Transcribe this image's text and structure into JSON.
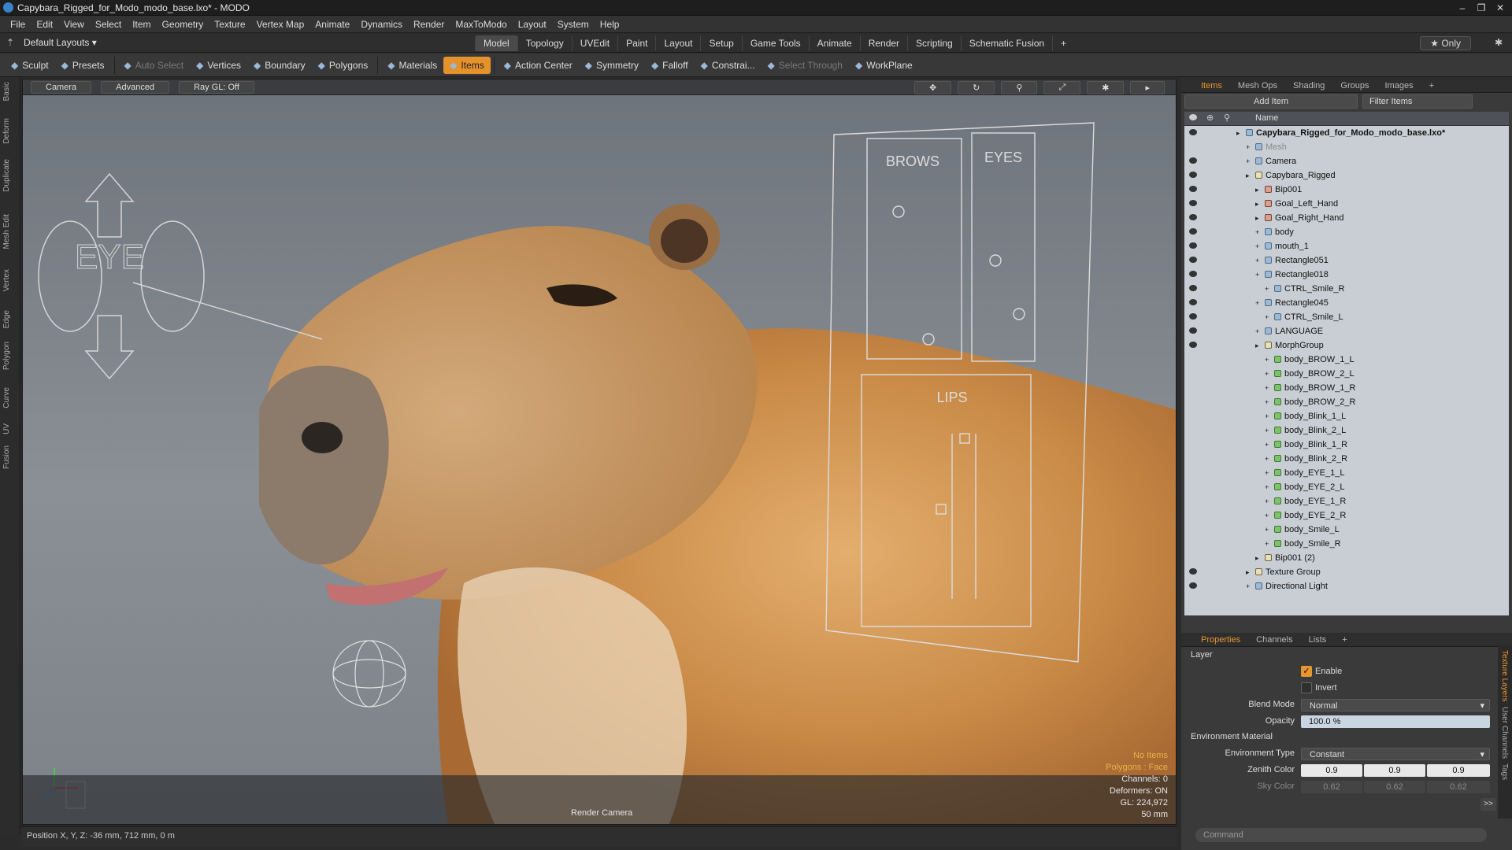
{
  "window": {
    "title": "Capybara_Rigged_for_Modo_modo_base.lxo* - MODO"
  },
  "menu": [
    "File",
    "Edit",
    "View",
    "Select",
    "Item",
    "Geometry",
    "Texture",
    "Vertex Map",
    "Animate",
    "Dynamics",
    "Render",
    "MaxToModo",
    "Layout",
    "System",
    "Help"
  ],
  "layout": {
    "default_layouts": "Default Layouts ▾",
    "tabs": [
      "Model",
      "Topology",
      "UVEdit",
      "Paint",
      "Layout",
      "Setup",
      "Game Tools",
      "Animate",
      "Render",
      "Scripting",
      "Schematic Fusion",
      "+"
    ],
    "active_tab": "Model",
    "only": "★ Only"
  },
  "toolbar": [
    "Sculpt",
    "Presets",
    "Auto Select",
    "Vertices",
    "Boundary",
    "Polygons",
    "Materials",
    "Items",
    "Action Center",
    "Symmetry",
    "Falloff",
    "Constrai...",
    "Select Through",
    "WorkPlane"
  ],
  "left_tabs": [
    "Basic",
    "Deform",
    "Duplicate",
    "Mesh Edit",
    "Vertex",
    "Edge",
    "Polygon",
    "Curve",
    "UV",
    "Fusion"
  ],
  "viewport": {
    "buttons": [
      "Camera",
      "Advanced",
      "Ray GL: Off"
    ],
    "label_eye": "EYE",
    "label_brows": "BROWS",
    "label_eyes": "EYES",
    "label_lips": "LIPS",
    "render_camera": "Render Camera",
    "stats": [
      "No Items",
      "Polygons : Face",
      "Channels: 0",
      "Deformers: ON",
      "GL: 224,972",
      "50 mm"
    ]
  },
  "status": {
    "position": "Position X, Y, Z:  -36 mm, 712 mm, 0 m"
  },
  "items_panel": {
    "tabs": [
      "Items",
      "Mesh Ops",
      "Shading",
      "Groups",
      "Images",
      "+"
    ],
    "add_item": "Add Item",
    "filter": "Filter Items",
    "column_name": "Name",
    "tree": [
      {
        "label": "Capybara_Rigged_for_Modo_modo_base.lxo*",
        "depth": 0,
        "kind": "scene",
        "bold": true
      },
      {
        "label": "Mesh",
        "depth": 1,
        "kind": "mesh",
        "gray": true
      },
      {
        "label": "Camera",
        "depth": 1,
        "kind": "cam"
      },
      {
        "label": "Capybara_Rigged",
        "depth": 1,
        "kind": "grp"
      },
      {
        "label": "Bip001",
        "depth": 2,
        "kind": "loc"
      },
      {
        "label": "Goal_Left_Hand",
        "depth": 2,
        "kind": "loc"
      },
      {
        "label": "Goal_Right_Hand",
        "depth": 2,
        "kind": "loc"
      },
      {
        "label": "body",
        "depth": 2,
        "kind": "mesh"
      },
      {
        "label": "mouth_1",
        "depth": 2,
        "kind": "mesh"
      },
      {
        "label": "Rectangle051",
        "depth": 2,
        "kind": "mesh"
      },
      {
        "label": "Rectangle018",
        "depth": 2,
        "kind": "mesh"
      },
      {
        "label": "CTRL_Smile_R",
        "depth": 3,
        "kind": "mesh"
      },
      {
        "label": "Rectangle045",
        "depth": 2,
        "kind": "mesh"
      },
      {
        "label": "CTRL_Smile_L",
        "depth": 3,
        "kind": "mesh"
      },
      {
        "label": "LANGUAGE",
        "depth": 2,
        "kind": "mesh"
      },
      {
        "label": "MorphGroup",
        "depth": 2,
        "kind": "grp"
      },
      {
        "label": "body_BROW_1_L",
        "depth": 3,
        "kind": "morph"
      },
      {
        "label": "body_BROW_2_L",
        "depth": 3,
        "kind": "morph"
      },
      {
        "label": "body_BROW_1_R",
        "depth": 3,
        "kind": "morph"
      },
      {
        "label": "body_BROW_2_R",
        "depth": 3,
        "kind": "morph"
      },
      {
        "label": "body_Blink_1_L",
        "depth": 3,
        "kind": "morph"
      },
      {
        "label": "body_Blink_2_L",
        "depth": 3,
        "kind": "morph"
      },
      {
        "label": "body_Blink_1_R",
        "depth": 3,
        "kind": "morph"
      },
      {
        "label": "body_Blink_2_R",
        "depth": 3,
        "kind": "morph"
      },
      {
        "label": "body_EYE_1_L",
        "depth": 3,
        "kind": "morph"
      },
      {
        "label": "body_EYE_2_L",
        "depth": 3,
        "kind": "morph"
      },
      {
        "label": "body_EYE_1_R",
        "depth": 3,
        "kind": "morph"
      },
      {
        "label": "body_EYE_2_R",
        "depth": 3,
        "kind": "morph"
      },
      {
        "label": "body_Smile_L",
        "depth": 3,
        "kind": "morph"
      },
      {
        "label": "body_Smile_R",
        "depth": 3,
        "kind": "morph"
      },
      {
        "label": "Bip001 (2)",
        "depth": 2,
        "kind": "grp"
      },
      {
        "label": "Texture Group",
        "depth": 1,
        "kind": "grp"
      },
      {
        "label": "Directional Light",
        "depth": 1,
        "kind": "light"
      }
    ]
  },
  "properties": {
    "tabs": [
      "Properties",
      "Channels",
      "Lists",
      "+"
    ],
    "section_layer": "Layer",
    "enable": "Enable",
    "invert": "Invert",
    "blend_mode_label": "Blend Mode",
    "blend_mode": "Normal",
    "opacity_label": "Opacity",
    "opacity": "100.0 %",
    "section_env": "Environment Material",
    "env_type_label": "Environment Type",
    "env_type": "Constant",
    "zenith_label": "Zenith Color",
    "zenith": [
      "0.9",
      "0.9",
      "0.9"
    ],
    "sky_label": "Sky Color",
    "sky": [
      "0.62",
      "0.62",
      "0.62"
    ],
    "more": ">>"
  },
  "right_vtabs": [
    "Texture Layers",
    "User Channels",
    "Tags"
  ],
  "command": {
    "placeholder": "Command"
  }
}
